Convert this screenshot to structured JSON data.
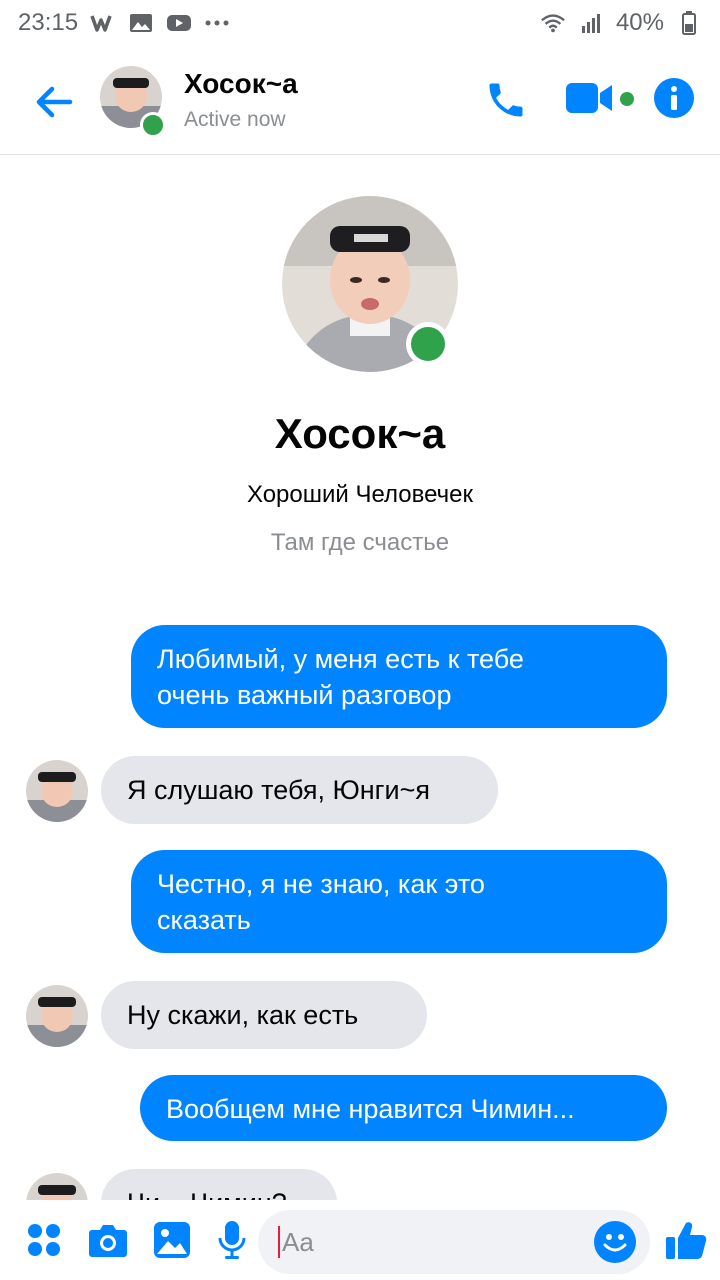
{
  "status_bar": {
    "time": "23:15",
    "battery": "40%"
  },
  "header": {
    "contact_name": "Хосок~a",
    "presence": "Active now"
  },
  "profile": {
    "name": "Хосок~a",
    "subtitle": "Хороший Человечек",
    "location": "Там где счастье"
  },
  "messages": [
    {
      "side": "out",
      "lines": [
        "Любимый, у меня есть к тебе",
        "очень важный разговор"
      ]
    },
    {
      "side": "in",
      "lines": [
        "Я слушаю тебя, Юнги~я"
      ]
    },
    {
      "side": "out",
      "lines": [
        "Честно, я не знаю, как это",
        "сказать"
      ]
    },
    {
      "side": "in",
      "lines": [
        "Ну скажи, как есть"
      ]
    },
    {
      "side": "out",
      "lines": [
        "Вообщем мне нравится Чимин..."
      ]
    },
    {
      "side": "in",
      "lines": [
        "Чи... Чимин?"
      ]
    }
  ],
  "composer": {
    "placeholder": "Aa"
  },
  "colors": {
    "accent": "#0084ff",
    "online": "#31a24c",
    "incoming_bubble": "#e4e6eb"
  },
  "icons": [
    "back-arrow-icon",
    "phone-icon",
    "video-camera-icon",
    "info-icon",
    "apps-icon",
    "camera-icon",
    "gallery-icon",
    "microphone-icon",
    "emoji-icon",
    "thumbs-up-icon"
  ]
}
